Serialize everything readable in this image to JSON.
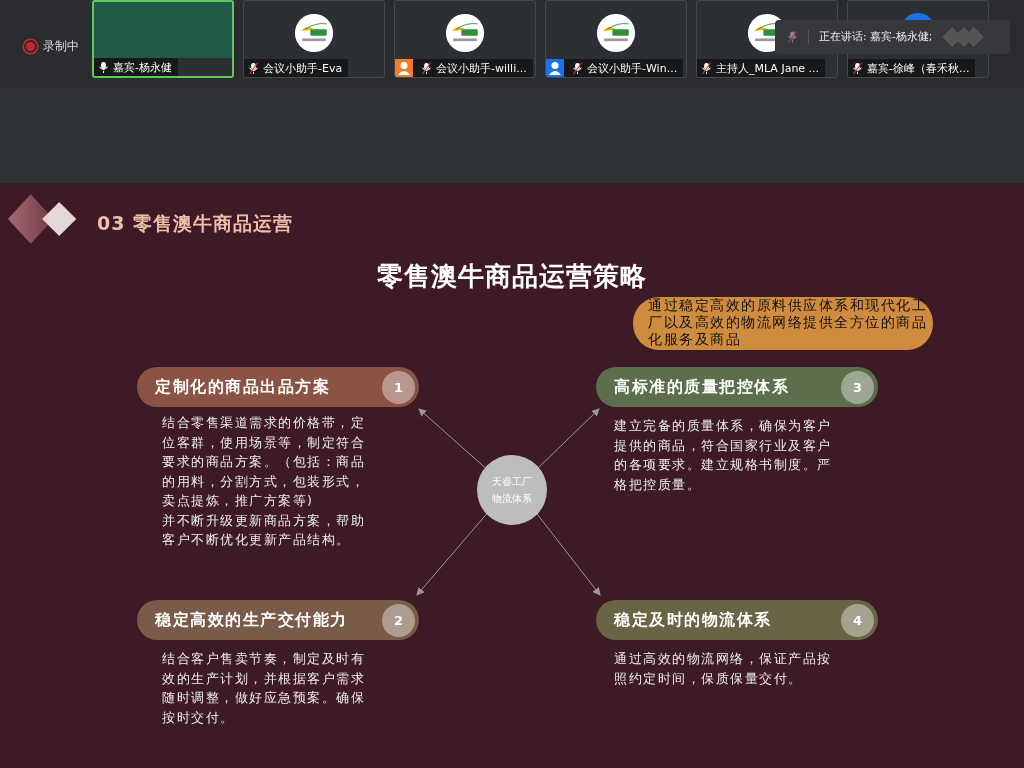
{
  "recording": {
    "label": "录制中"
  },
  "participants": [
    {
      "name": "嘉宾-杨永健",
      "kind": "video",
      "muted": false,
      "speaking": true
    },
    {
      "name": "会议小助手-Eva",
      "kind": "logo",
      "muted": true,
      "speaking": false
    },
    {
      "name": "会议小助手-willi...",
      "kind": "logo",
      "muted": true,
      "speaking": false,
      "color": "#f07c2c"
    },
    {
      "name": "会议小助手-Win...",
      "kind": "logo",
      "muted": true,
      "speaking": false,
      "color": "#1a73e8"
    },
    {
      "name": "主持人_MLA Jane ...",
      "kind": "logo",
      "muted": true,
      "speaking": false
    },
    {
      "name": "嘉宾-徐峰（春禾秋...",
      "kind": "avatar",
      "muted": true,
      "speaking": false
    }
  ],
  "speaking_toast": {
    "text": "正在讲话: 嘉宾-杨永健;"
  },
  "slide": {
    "section": "03 零售澳牛商品运营",
    "title": "零售澳牛商品运营策略",
    "callout": "通过稳定高效的原料供应体系和现代化工厂以及高效的物流网络提供全方位的商品化服务及商品",
    "center": [
      "天睿工厂",
      "物流体系"
    ],
    "cards": [
      {
        "number": "1",
        "title": "定制化的商品出品方案",
        "color": "#8a5344",
        "body": "结合零售渠道需求的价格带，定位客群，使用场景等，制定符合要求的商品方案。（包括：商品的用料，分割方式，包装形式，卖点提炼，推广方案等)\n并不断升级更新商品方案，帮助客户不断优化更新产品结构。"
      },
      {
        "number": "2",
        "title": "稳定高效的生产交付能力",
        "color": "#7a5a48",
        "body": "结合客户售卖节奏，制定及时有效的生产计划，并根据客户需求随时调整，做好应急预案。确保按时交付。"
      },
      {
        "number": "3",
        "title": "高标准的质量把控体系",
        "color": "#5d6e4d",
        "body": "建立完备的质量体系，确保为客户提供的商品，符合国家行业及客户的各项要求。建立规格书制度。严格把控质量。"
      },
      {
        "number": "4",
        "title": "稳定及时的物流体系",
        "color": "#6a6446",
        "body": "通过高效的物流网络，保证产品按照约定时间，保质保量交付。"
      }
    ]
  }
}
